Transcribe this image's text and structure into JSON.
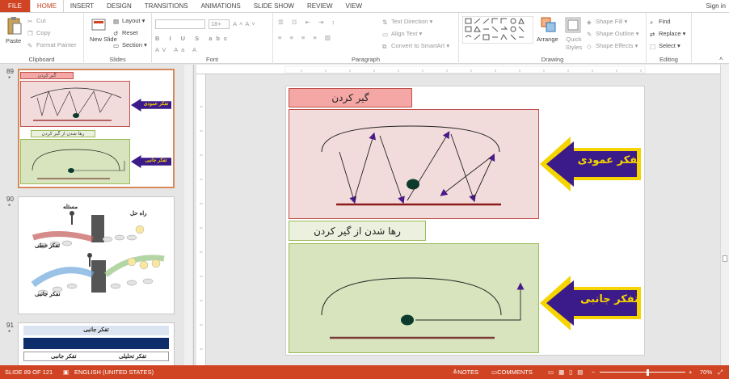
{
  "tabs": [
    "FILE",
    "HOME",
    "INSERT",
    "DESIGN",
    "TRANSITIONS",
    "ANIMATIONS",
    "SLIDE SHOW",
    "REVIEW",
    "VIEW"
  ],
  "signin": "Sign in",
  "ribbon": {
    "clipboard": {
      "paste": "Paste",
      "cut": "Cut",
      "copy": "Copy",
      "format_painter": "Format Painter",
      "label": "Clipboard"
    },
    "slides": {
      "new_slide": "New Slide",
      "layout": "Layout",
      "reset": "Reset",
      "section": "Section",
      "label": "Slides"
    },
    "font": {
      "size": "18+",
      "label": "Font"
    },
    "paragraph": {
      "text_direction": "Text Direction",
      "align_text": "Align Text",
      "convert_smartart": "Convert to SmartArt",
      "label": "Paragraph"
    },
    "drawing": {
      "arrange": "Arrange",
      "quick_styles": "Quick Styles",
      "shape_fill": "Shape Fill",
      "shape_outline": "Shape Outline",
      "shape_effects": "Shape Effects",
      "label": "Drawing"
    },
    "editing": {
      "find": "Find",
      "replace": "Replace",
      "select": "Select",
      "label": "Editing"
    }
  },
  "thumbnails": [
    {
      "num": "89",
      "star": "*",
      "t1": "گیر کردن",
      "t2": "تفکر عمودی",
      "t3": "رها شدن از گیر کردن",
      "t4": "تفکر جانبی"
    },
    {
      "num": "90",
      "star": "*",
      "a": "مسئله",
      "b": "راه حل",
      "c": "تفکر خطی",
      "d": "تفکر جانبی"
    },
    {
      "num": "91",
      "star": "*",
      "a": "تفکر جانبی",
      "b": "تفکر جانبی",
      "c": "تفکر تحلیلی"
    }
  ],
  "slide": {
    "title_stuck": "گیر کردن",
    "vertical_thinking": "تفکر عمودی",
    "title_release": "رها شدن از گیر کردن",
    "lateral_thinking": "تفکر جانبی"
  },
  "status": {
    "slide_info": "SLIDE 89 OF 121",
    "language": "ENGLISH (UNITED STATES)",
    "notes": "NOTES",
    "comments": "COMMENTS",
    "zoom": "70%"
  },
  "colors": {
    "accent": "#d04423",
    "pink_fill": "#f2dcdb",
    "green_fill": "#d7e4bd",
    "arrow_purple": "#3b1a8a",
    "arrow_yellow": "#f5d400"
  }
}
